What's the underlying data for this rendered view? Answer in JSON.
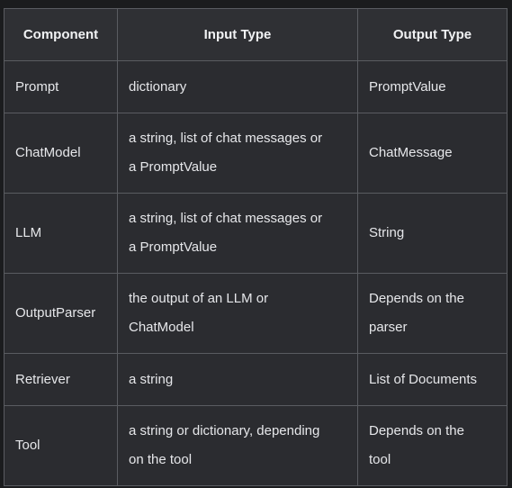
{
  "table": {
    "headers": [
      "Component",
      "Input Type",
      "Output Type"
    ],
    "rows": [
      {
        "component": "Prompt",
        "input": "dictionary",
        "output": "PromptValue"
      },
      {
        "component": "ChatModel",
        "input_lines": [
          "a string, list of chat messages or",
          "a PromptValue"
        ],
        "output": "ChatMessage"
      },
      {
        "component": "LLM",
        "input_lines": [
          "a string, list of chat messages or",
          "a PromptValue"
        ],
        "output": "String"
      },
      {
        "component": "OutputParser",
        "input_lines": [
          "the output of an LLM or",
          "ChatModel"
        ],
        "output_lines": [
          "Depends on the",
          "parser"
        ]
      },
      {
        "component": "Retriever",
        "input": "a string",
        "output": "List of Documents"
      },
      {
        "component": "Tool",
        "input_lines": [
          "a string or dictionary, depending",
          "on the tool"
        ],
        "output_lines": [
          "Depends on the",
          "tool"
        ]
      }
    ]
  }
}
